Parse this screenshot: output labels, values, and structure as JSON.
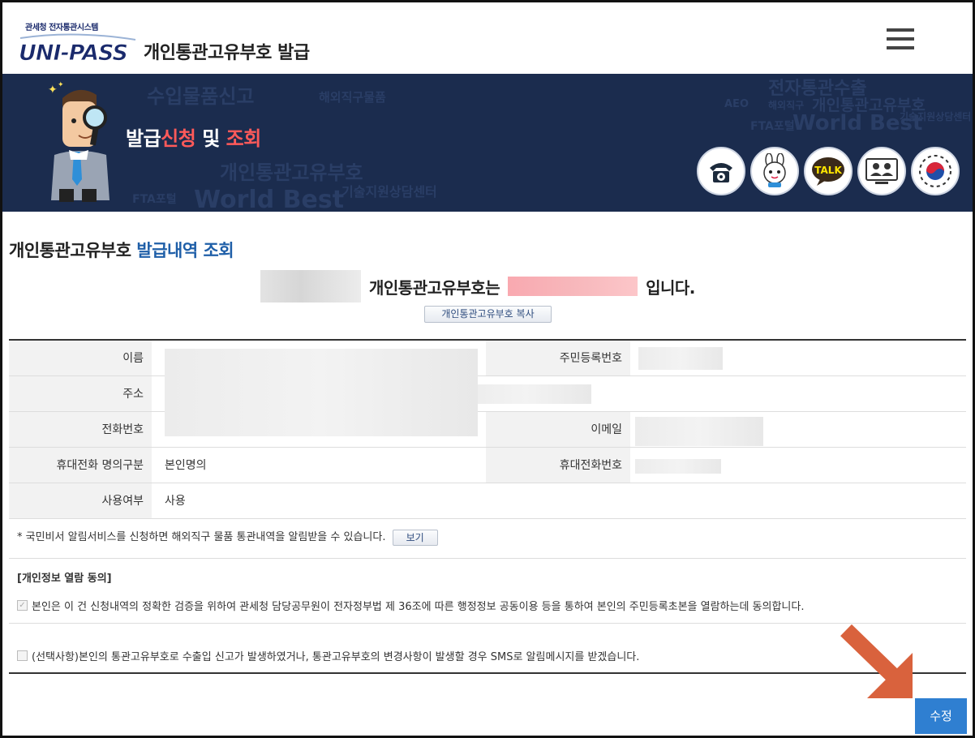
{
  "header": {
    "logo_subtext": "관세청 전자통관시스템",
    "logo_text": "UNI-PASS",
    "title": "개인통관고유부호 발급"
  },
  "banner": {
    "title_part1": "발급",
    "title_part2": "신청",
    "title_part3": " 및 ",
    "title_part4": "조회",
    "bg_words": [
      "수입물품신고",
      "해외직구물품",
      "전자통관수출",
      "개인통관고유부호",
      "FTA포털",
      "World Best",
      "기술지원상담센터",
      "AEO",
      "해외직구",
      "개인통관고유부호",
      "World Best",
      "기술지원상담센터",
      "FTA포털"
    ],
    "icons": [
      "telephone-icon",
      "mascot-icon",
      "talk-icon",
      "video-consult-icon",
      "government-emblem-icon"
    ],
    "talk_label": "TALK"
  },
  "main": {
    "section_title_part1": "개인통관고유부호",
    "section_title_part2": " 발급내역 조회",
    "number_sentence_mid": "개인통관고유부호는",
    "number_sentence_end": "입니다.",
    "copy_button": "개인통관고유부호 복사"
  },
  "table": {
    "name_label": "이름",
    "rrn_label": "주민등록번호",
    "address_label": "주소",
    "phone_label": "전화번호",
    "email_label": "이메일",
    "mobile_owner_label": "휴대전화 명의구분",
    "mobile_owner_value": "본인명의",
    "mobile_label": "휴대전화번호",
    "usage_label": "사용여부",
    "usage_value": "사용"
  },
  "notice": {
    "text": "* 국민비서 알림서비스를 신청하면 해외직구 물품 통관내역을 알림받을 수 있습니다.",
    "button": "보기"
  },
  "consent": {
    "title": "[개인정보 열람 동의]",
    "agree_text": "본인은 이 건 신청내역의 정확한 검증을 위하여 관세청 담당공무원이 전자정부법 제 36조에 따른 행정정보 공동이용 등을 통하여 본인의 주민등록초본을 열람하는데 동의합니다.",
    "agree_checked": true,
    "sms_text": "(선택사항)본인의 통관고유부호로 수출입 신고가 발생하였거나, 통관고유부호의 변경사항이 발생할 경우 SMS로 알림메시지를 받겠습니다.",
    "sms_checked": false
  },
  "actions": {
    "edit_button": "수정"
  },
  "colors": {
    "banner_bg": "#1b2c4e",
    "accent_blue": "#1f5fa8",
    "highlight_red": "#ff5a5a",
    "button_blue": "#2f7fd1",
    "arrow_orange": "#d9623d"
  }
}
